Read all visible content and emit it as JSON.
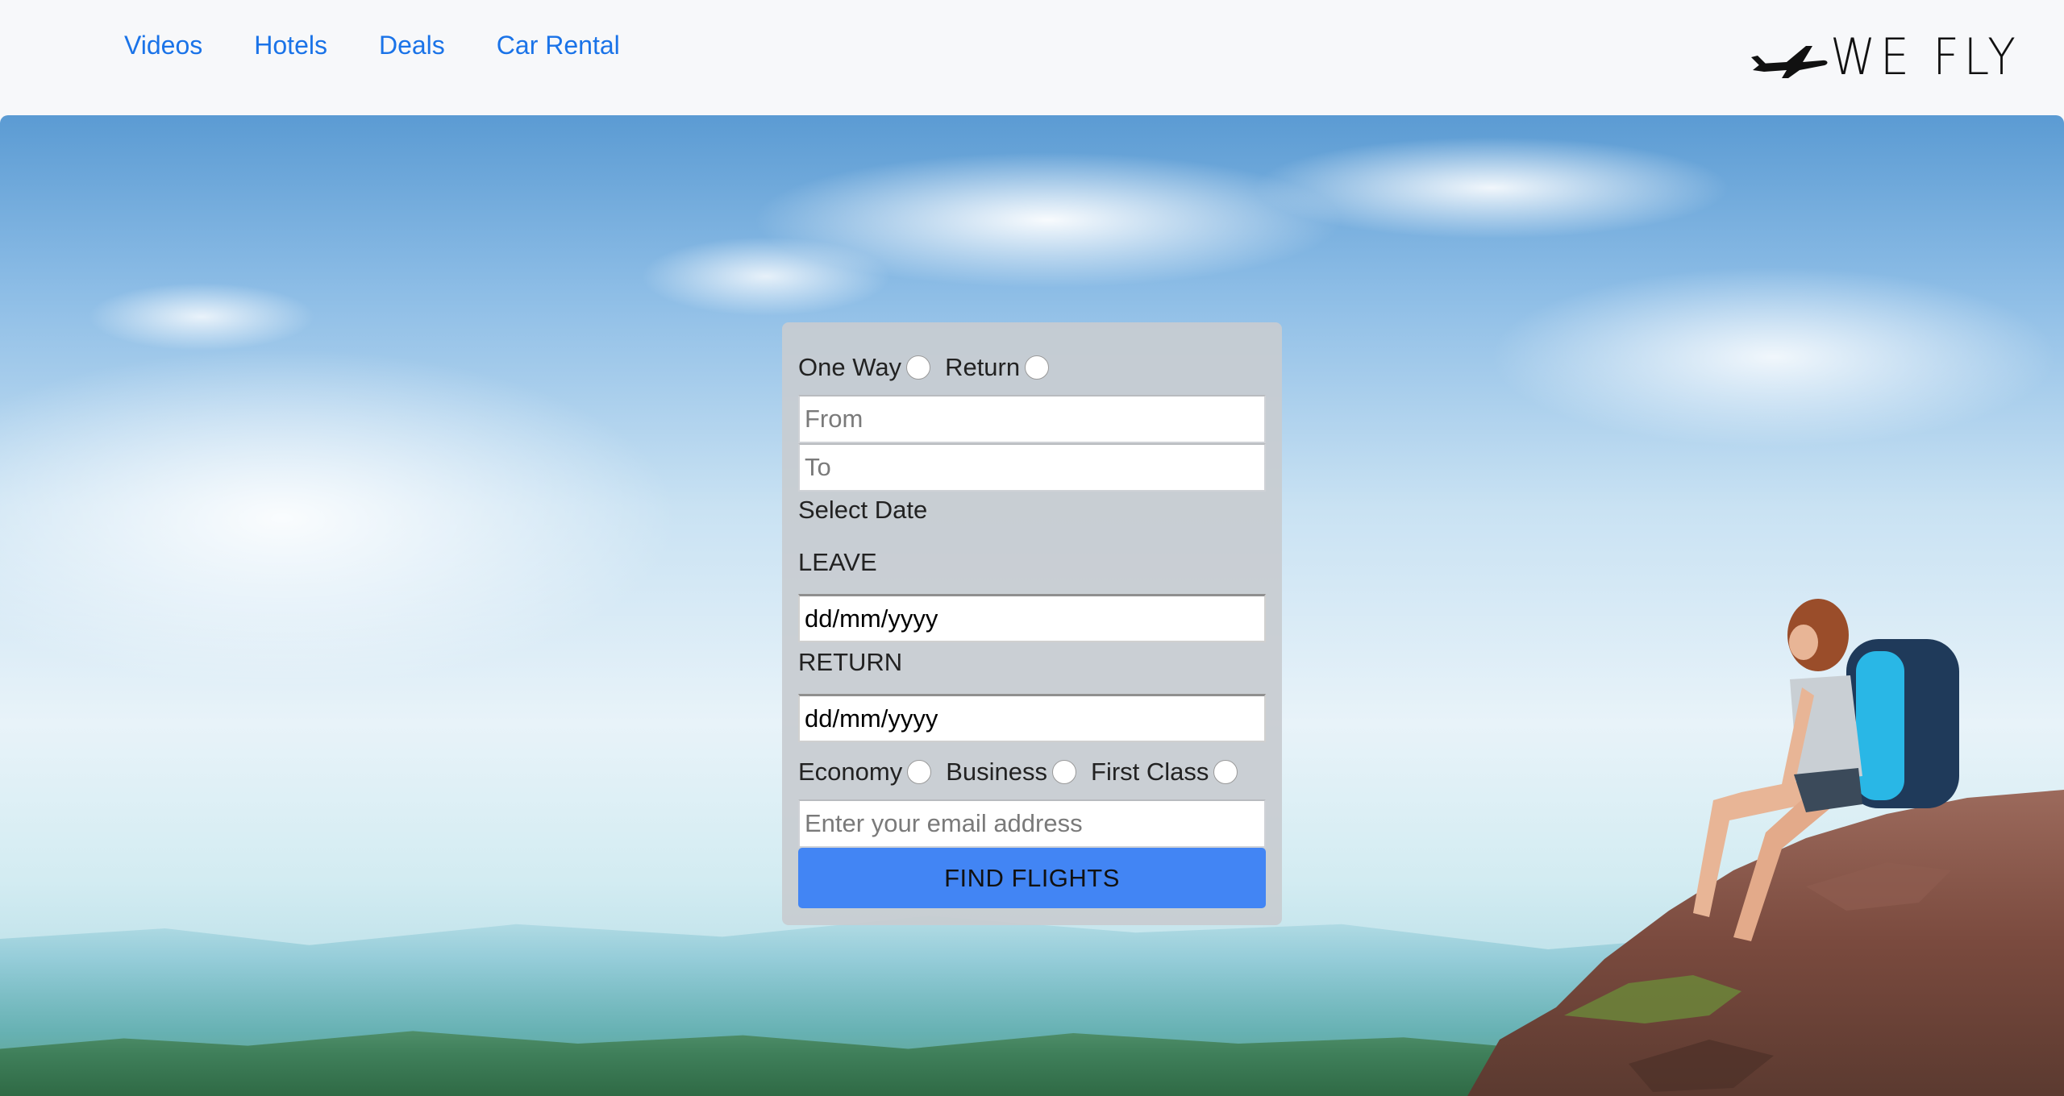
{
  "nav": {
    "links": [
      {
        "label": "Videos"
      },
      {
        "label": "Hotels"
      },
      {
        "label": "Deals"
      },
      {
        "label": "Car Rental"
      }
    ],
    "link_color": "#1a73e8"
  },
  "brand": {
    "name": "WE FLY",
    "icon": "airplane-icon"
  },
  "form": {
    "trip_type": {
      "options": [
        {
          "label": "One Way",
          "checked": false
        },
        {
          "label": "Return",
          "checked": false
        }
      ]
    },
    "from_placeholder": "From",
    "to_placeholder": "To",
    "select_date_label": "Select Date",
    "leave_label": "LEAVE",
    "leave_value": "dd/mm/yyyy",
    "return_label": "RETURN",
    "return_value": "dd/mm/yyyy",
    "cabin_class": {
      "options": [
        {
          "label": "Economy",
          "checked": false
        },
        {
          "label": "Business",
          "checked": false
        },
        {
          "label": "First Class",
          "checked": false
        }
      ]
    },
    "email_placeholder": "Enter your email address",
    "submit_label": "FIND FLIGHTS",
    "submit_color": "#4285f4"
  }
}
